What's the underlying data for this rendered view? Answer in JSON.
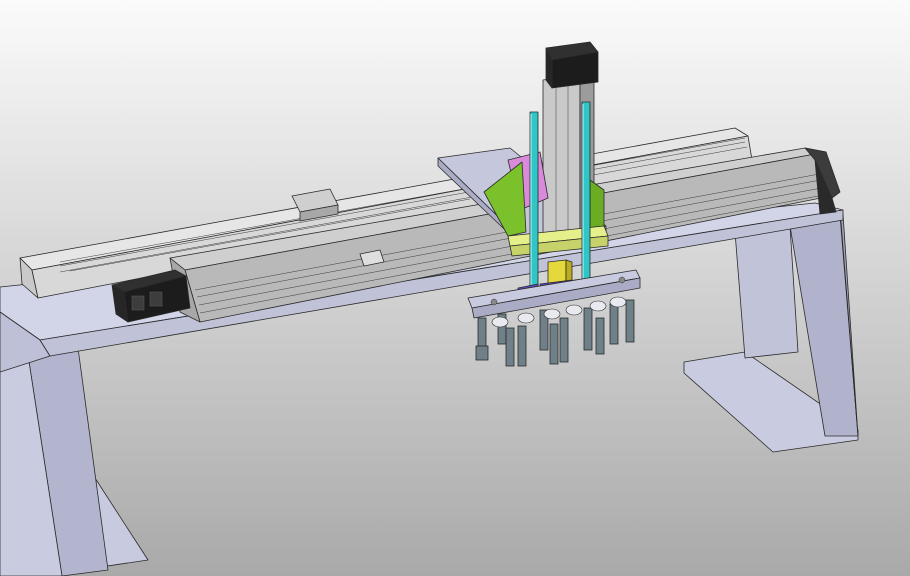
{
  "viewport": {
    "background_top": "#fbfbfb",
    "background_bottom": "#a9a9a9"
  },
  "colors": {
    "frame_face": "#c5c8dc",
    "frame_top": "#d3d6ea",
    "frame_side": "#a9acc4",
    "rail_light": "#e4e4e4",
    "rail_mid": "#bcbcbc",
    "rail_dark": "#8e8e8e",
    "motor_black": "#1c1c1c",
    "rod_cyan": "#2ec6c6",
    "bracket_green": "#7ac12b",
    "block_pink": "#d98ad8",
    "plate_yellow": "#e6f08a",
    "nut_blue": "#5a48c8",
    "coupler_gold": "#e4d83a",
    "gripper_grey": "#6f8088"
  },
  "icons": [
    "x-axis-servo-motor",
    "z-axis-servo-motor",
    "gripper-assembly"
  ]
}
